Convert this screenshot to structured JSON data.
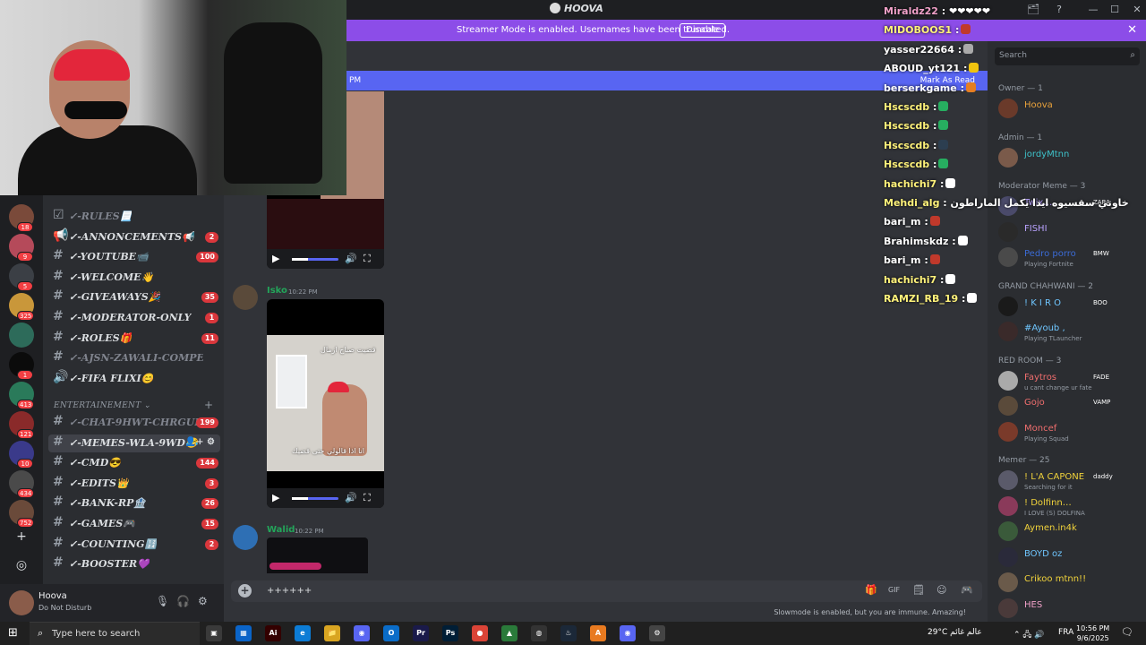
{
  "window": {
    "title": "HOOVA",
    "controls": [
      "🗂",
      "?",
      "—",
      "☐",
      "✕"
    ]
  },
  "banner": {
    "text": "Streamer Mode is enabled. Usernames have been truncated.",
    "button": "Disable",
    "close": "✕"
  },
  "rail": {
    "servers": [
      {
        "color": "#7a4a3a",
        "badge": "18"
      },
      {
        "color": "#b54a5a",
        "badge": "9"
      },
      {
        "color": "#3b3f45",
        "badge": "5"
      },
      {
        "color": "#c9973a",
        "badge": "325"
      },
      {
        "color": "#2d6b5a",
        "badge": ""
      },
      {
        "color": "#0b0b0b",
        "badge": "1"
      },
      {
        "color": "#2a7a5a",
        "badge": "413"
      },
      {
        "color": "#8a2a2a",
        "badge": "121"
      },
      {
        "color": "#3a3a8a",
        "badge": "10"
      },
      {
        "color": "#4a4a4a",
        "badge": "434"
      },
      {
        "color": "#6a4a3a",
        "badge": "752"
      }
    ],
    "add_icon": "+",
    "discover_icon": "◎"
  },
  "channels": {
    "items": [
      {
        "prefix": "☑",
        "name": "✓-RULES📃",
        "badge": "",
        "muted": true
      },
      {
        "prefix": "📢",
        "name": "✓-ANNONCEMENTS📢",
        "badge": "2",
        "muted": false
      },
      {
        "prefix": "#",
        "name": "✓-YOUTUBE📹",
        "badge": "100",
        "muted": false
      },
      {
        "prefix": "#",
        "name": "✓-WELCOME👋",
        "badge": "",
        "muted": false
      },
      {
        "prefix": "#",
        "name": "✓-GIVEAWAYS🎉",
        "badge": "35",
        "muted": false
      },
      {
        "prefix": "#",
        "name": "✓-MODERATOR-ONLY",
        "badge": "1",
        "muted": false
      },
      {
        "prefix": "#",
        "name": "✓-ROLES🎁",
        "badge": "11",
        "muted": false
      },
      {
        "prefix": "#",
        "name": "✓-AJSN-ZAWALI-COMPETE…",
        "badge": "",
        "muted": true
      },
      {
        "prefix": "🔊",
        "name": "✓-FIFA FLIXI😊",
        "badge": "",
        "muted": false
      }
    ],
    "category": "ENTERTAINEMENT ⌄",
    "category_plus": "+",
    "items2": [
      {
        "prefix": "#",
        "name": "✓-CHAT-9HWT-CHRGUI",
        "badge": "199",
        "muted": true
      },
      {
        "prefix": "#",
        "name": "✓-MEMES-WLA-9WD😂",
        "badge": "",
        "muted": false,
        "active": true
      },
      {
        "prefix": "#",
        "name": "✓-CMD😎",
        "badge": "144",
        "muted": false
      },
      {
        "prefix": "#",
        "name": "✓-EDITS👑",
        "badge": "3",
        "muted": false
      },
      {
        "prefix": "#",
        "name": "✓-BANK-RP🏦",
        "badge": "26",
        "muted": false
      },
      {
        "prefix": "#",
        "name": "✓-GAMES🎮",
        "badge": "15",
        "muted": false
      },
      {
        "prefix": "#",
        "name": "✓-COUNTING🔢",
        "badge": "2",
        "muted": false
      },
      {
        "prefix": "#",
        "name": "✓-BOOSTER💜",
        "badge": "",
        "muted": false
      }
    ],
    "active_actions": "👤+ ⚙"
  },
  "user": {
    "name": "Hoova",
    "status": "Do Not Disturb",
    "icons": [
      "🎙",
      "🎧",
      "⚙"
    ]
  },
  "messages": {
    "new_bar_left": "PM",
    "new_bar_right": "Mark As Read",
    "posts": [
      {
        "author": "Isko",
        "time": "10:22 PM",
        "caption_top": "قضيت صباح ازمال",
        "caption_bottom": "انا اذا قالولي حتى قضيك"
      },
      {
        "author": "Walid",
        "time": "10:22 PM"
      }
    ],
    "composer_text": "++++++",
    "composer_icons": [
      "🎁",
      "GIF",
      "🗒",
      "☺",
      "🎮"
    ],
    "slowmode": "Slowmode is enabled, but you are immune. Amazing!"
  },
  "chat": [
    {
      "user": "Miraldz22",
      "msg": ": ❤❤❤❤❤",
      "color": "#f0a0c8"
    },
    {
      "user": "MIDOBOOS1",
      "msg": ":",
      "color": "#fff27a"
    },
    {
      "user": "yasser22664",
      "msg": ":",
      "color": "#ffffff"
    },
    {
      "user": "ABOUD_yt121",
      "msg": ":",
      "color": "#ffffff"
    },
    {
      "user": "berserkgame",
      "msg": ":",
      "color": "#ffffff"
    },
    {
      "user": "Hscscdb",
      "msg": ":",
      "color": "#fff27a"
    },
    {
      "user": "Hscscdb",
      "msg": ":",
      "color": "#fff27a"
    },
    {
      "user": "Hscscdb",
      "msg": ":",
      "color": "#fff27a"
    },
    {
      "user": "Hscscdb",
      "msg": ":",
      "color": "#fff27a"
    },
    {
      "user": "hachichi7",
      "msg": ":",
      "color": "#fff27a"
    },
    {
      "user": "Mehdi_alg",
      "msg": ": خاوتي سقسيوه ايدا يكمل الماراطون",
      "color": "#fff27a"
    },
    {
      "user": "bari_m",
      "msg": ":",
      "color": "#ffffff"
    },
    {
      "user": "Brahimskdz",
      "msg": ":",
      "color": "#ffffff"
    },
    {
      "user": "bari_m",
      "msg": ":",
      "color": "#ffffff"
    },
    {
      "user": "hachichi7",
      "msg": ":",
      "color": "#fff27a"
    },
    {
      "user": "RAMZI_RB_19",
      "msg": ":",
      "color": "#fff27a"
    }
  ],
  "members": {
    "search_placeholder": "Search",
    "groups": [
      {
        "label": "Owner — 1",
        "members": [
          {
            "name": "Hoova",
            "color": "#e9a23b",
            "activity": "",
            "tag": "",
            "av": "#6a3a2a"
          }
        ]
      },
      {
        "label": "Admin — 1",
        "members": [
          {
            "name": "jordyMtnn",
            "color": "#3ec1c9",
            "activity": "",
            "tag": "",
            "av": "#7a5a4a"
          }
        ]
      },
      {
        "label": "Moderator Meme — 3",
        "members": [
          {
            "name": "Twix…",
            "color": "#b9a2ff",
            "activity": "",
            "tag": "ZARA",
            "av": "#4a4a6a"
          },
          {
            "name": "FISHI",
            "color": "#b9a2ff",
            "activity": "",
            "tag": "",
            "av": "#2a2a2a"
          },
          {
            "name": "Pedro porro",
            "color": "#3b6bd6",
            "activity": "Playing Fortnite",
            "tag": "BMW",
            "av": "#4a4a4a"
          }
        ]
      },
      {
        "label": "GRAND CHAHWANI — 2",
        "members": [
          {
            "name": "! K I R O",
            "color": "#6fc6ff",
            "activity": "",
            "tag": "BOO",
            "av": "#1a1a1a"
          },
          {
            "name": "#Ayoub ,",
            "color": "#6fc6ff",
            "activity": "Playing TLauncher",
            "tag": "",
            "av": "#3a2a2a"
          }
        ]
      },
      {
        "label": "RED ROOM — 3",
        "members": [
          {
            "name": "Faytros",
            "color": "#f06e6e",
            "activity": "u cant change ur fate",
            "tag": "FADE",
            "av": "#aaa"
          },
          {
            "name": "Gojo",
            "color": "#f06e6e",
            "activity": "",
            "tag": "VAMP",
            "av": "#5a4a3a"
          },
          {
            "name": "Moncef",
            "color": "#f06e6e",
            "activity": "Playing Squad",
            "tag": "",
            "av": "#7a3a2a"
          }
        ]
      },
      {
        "label": "Memer — 25",
        "members": [
          {
            "name": "! L'A CAPONE",
            "color": "#f0d23b",
            "activity": "Searching for it",
            "tag": "daddy",
            "av": "#5a5a6a"
          },
          {
            "name": "! Dolfinn…",
            "color": "#f0d23b",
            "activity": "I LOVE (S) DOLFINA",
            "tag": "",
            "av": "#8a3a5a"
          },
          {
            "name": "Aymen.in4k",
            "color": "#f0d23b",
            "activity": "",
            "tag": "",
            "av": "#3a5a3a"
          },
          {
            "name": "BOYD oz",
            "color": "#6fc6ff",
            "activity": "",
            "tag": "",
            "av": "#2a2a3a"
          },
          {
            "name": "Crikoo mtnn!!",
            "color": "#f0d23b",
            "activity": "",
            "tag": "",
            "av": "#6a5a4a"
          },
          {
            "name": "HES",
            "color": "#f0a0c8",
            "activity": "",
            "tag": "",
            "av": "#4a3a3a"
          }
        ]
      }
    ]
  },
  "taskbar": {
    "search_placeholder": "Type here to search",
    "apps": [
      {
        "label": "▣",
        "color": "#3a3a3a"
      },
      {
        "label": "▦",
        "color": "#0a64c8"
      },
      {
        "label": "Ai",
        "color": "#300"
      },
      {
        "label": "e",
        "color": "#0c7cd5"
      },
      {
        "label": "📁",
        "color": "#d9a521"
      },
      {
        "label": "◉",
        "color": "#5865f2"
      },
      {
        "label": "O",
        "color": "#0a6cc8"
      },
      {
        "label": "Pr",
        "color": "#1a1a4a"
      },
      {
        "label": "Ps",
        "color": "#001e36"
      },
      {
        "label": "●",
        "color": "#db4437"
      },
      {
        "label": "▲",
        "color": "#2a7a3a"
      },
      {
        "label": "◍",
        "color": "#333"
      },
      {
        "label": "♨",
        "color": "#1b2838"
      },
      {
        "label": "A",
        "color": "#e87a20"
      },
      {
        "label": "◉",
        "color": "#5865f2"
      },
      {
        "label": "⚙",
        "color": "#444"
      }
    ],
    "weather": "29°C  عالم غائم",
    "lang": "FRA",
    "time": "10:56 PM",
    "date": "9/6/2025"
  }
}
